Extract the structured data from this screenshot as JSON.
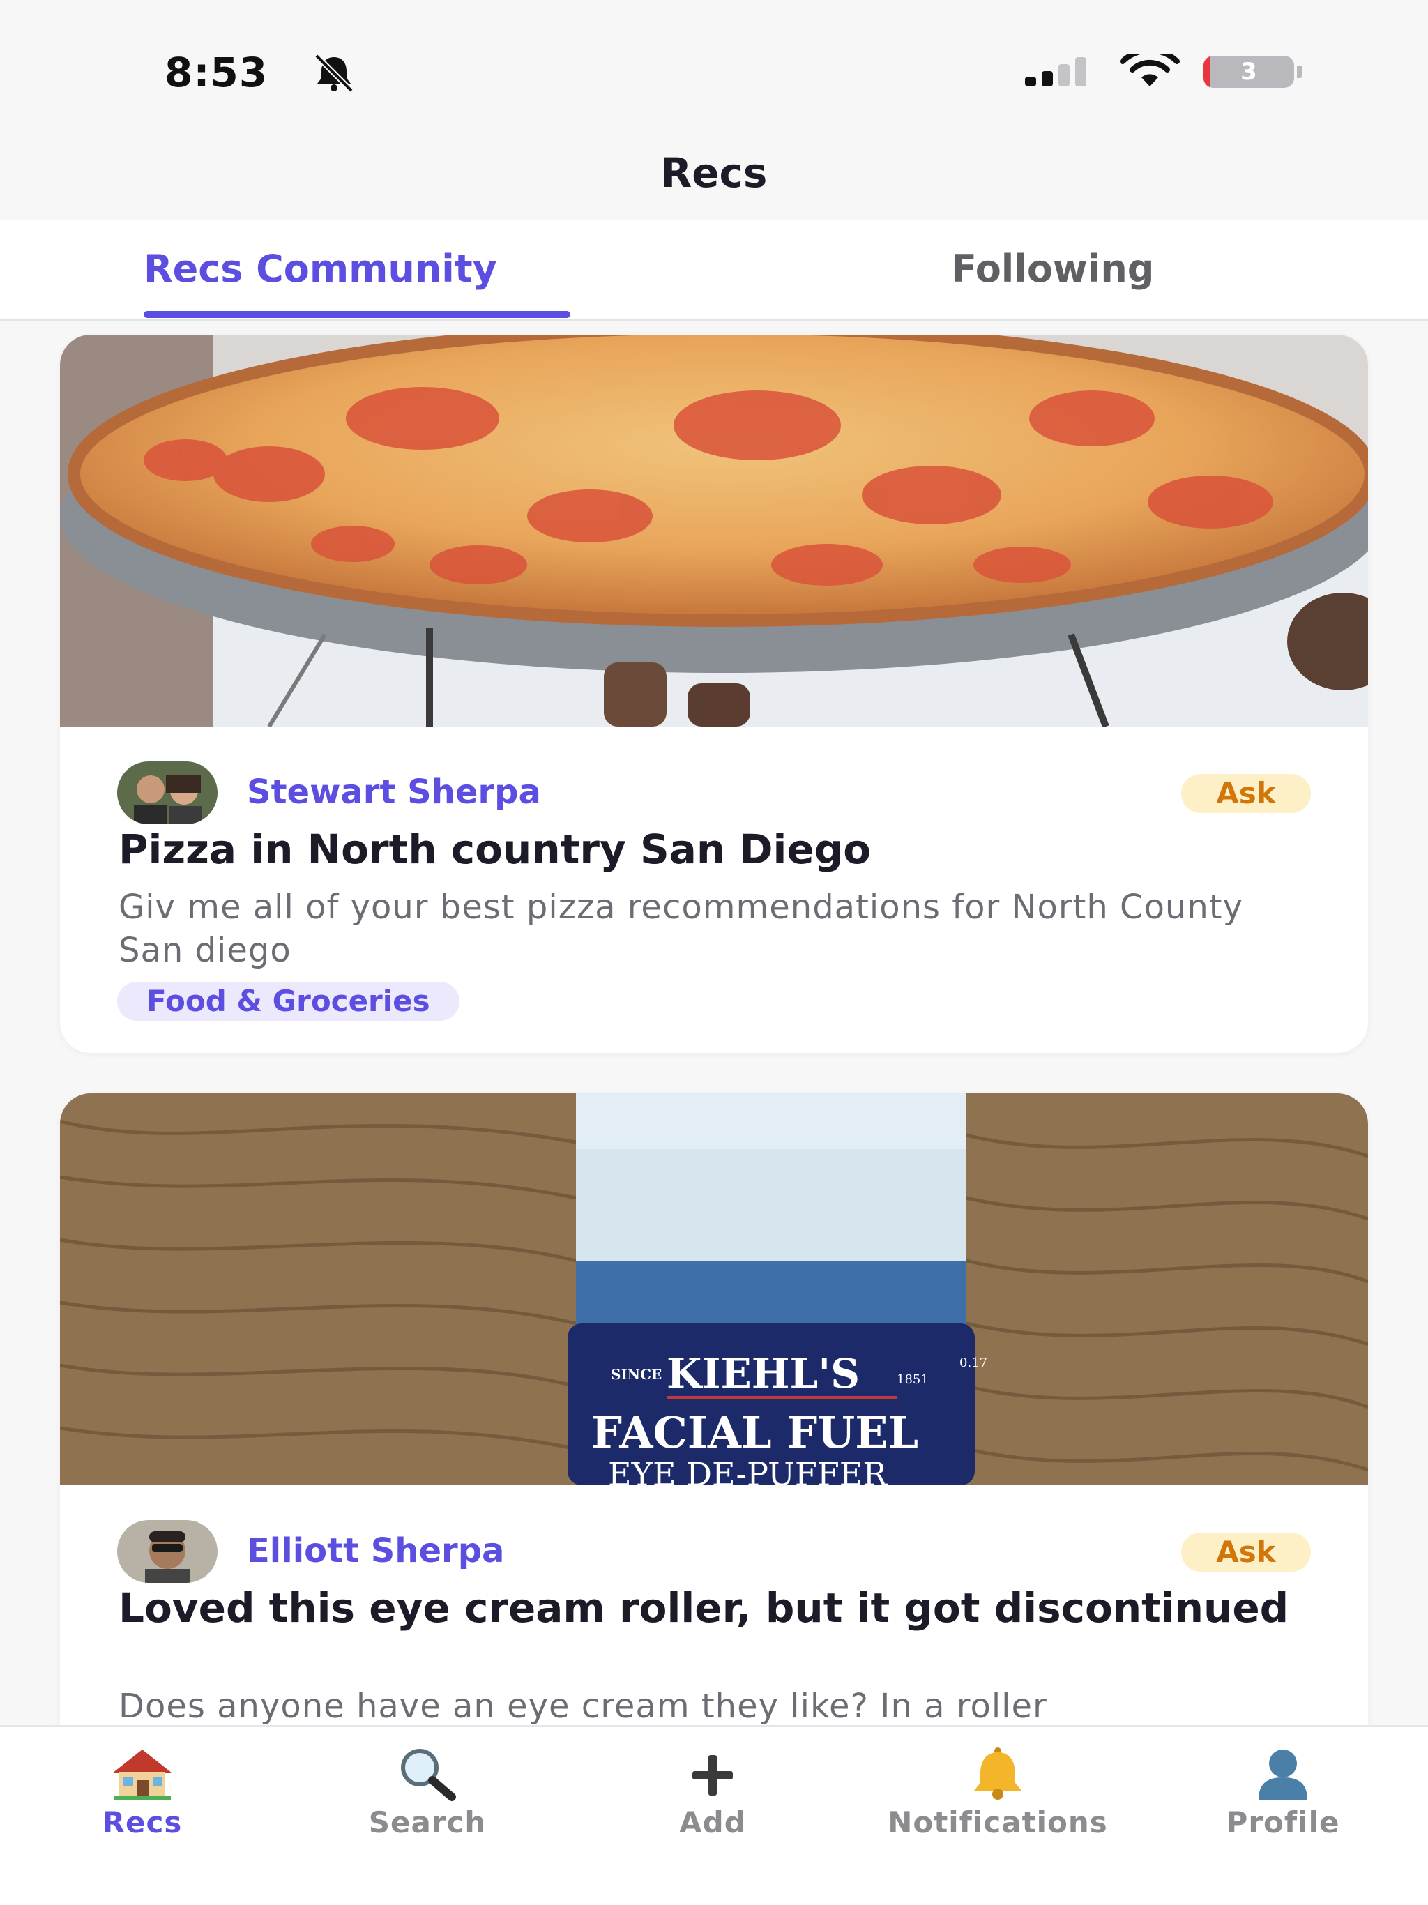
{
  "status_bar": {
    "time": "8:53",
    "battery_level": "3"
  },
  "nav": {
    "title": "Recs"
  },
  "tabs": [
    {
      "label": "Recs Community",
      "active": true
    },
    {
      "label": "Following",
      "active": false
    }
  ],
  "posts": [
    {
      "author": "Stewart Sherpa",
      "badge": "Ask",
      "title": "Pizza in North country San Diego",
      "body": "Giv me all of your best pizza recommendations for North County San diego",
      "category": "Food & Groceries",
      "image": "pizza-photo"
    },
    {
      "author": "Elliott Sherpa",
      "badge": "Ask",
      "title": "Loved this eye cream roller, but it got discontinued",
      "body": "Does anyone have an eye cream they like? In a roller",
      "image": "eye-cream-photo",
      "product_text": {
        "since": "SINCE",
        "brand": "KIEHL'S",
        "year": "1851",
        "size": "0.17",
        "line1": "FACIAL FUEL",
        "line2": "EYE DE-PUFFER"
      }
    }
  ],
  "bottom_nav": [
    {
      "label": "Recs",
      "icon": "house-icon",
      "active": true
    },
    {
      "label": "Search",
      "icon": "magnifier-icon",
      "active": false
    },
    {
      "label": "Add",
      "icon": "plus-icon",
      "active": false
    },
    {
      "label": "Notifications",
      "icon": "bell-icon",
      "active": false
    },
    {
      "label": "Profile",
      "icon": "person-icon",
      "active": false
    }
  ],
  "colors": {
    "accent": "#5b4ee0",
    "badge_bg": "#fdf0c6",
    "badge_text": "#d0760b",
    "tag_bg": "#ece9fd"
  }
}
